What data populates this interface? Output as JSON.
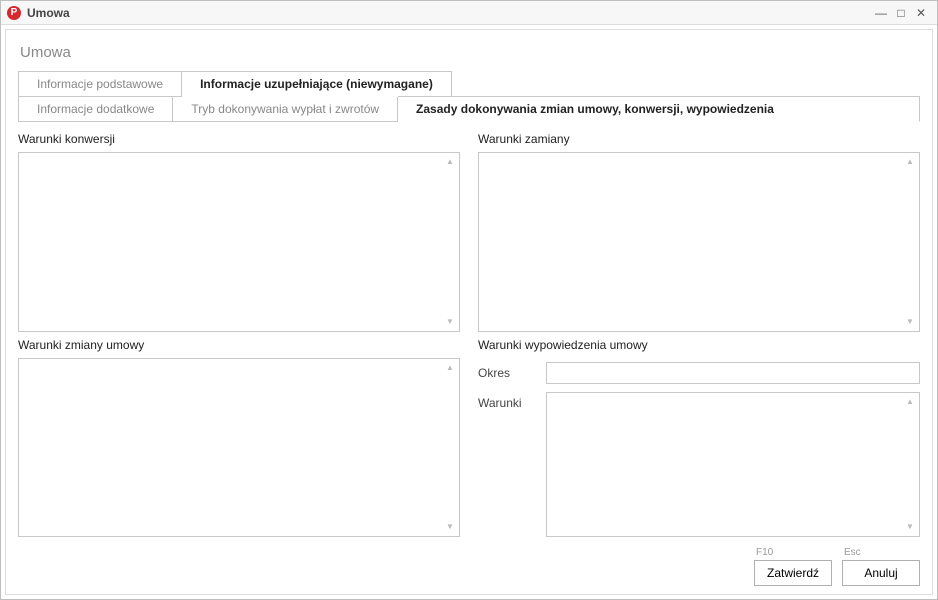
{
  "window": {
    "title": "Umowa",
    "icon_letter": "P"
  },
  "page": {
    "title": "Umowa"
  },
  "tabs_primary": [
    {
      "label": "Informacje podstawowe",
      "active": false
    },
    {
      "label": "Informacje uzupełniające (niewymagane)",
      "active": true
    }
  ],
  "tabs_secondary": [
    {
      "label": "Informacje dodatkowe",
      "active": false
    },
    {
      "label": "Tryb dokonywania wypłat i zwrotów",
      "active": false
    },
    {
      "label": "Zasady dokonywania zmian umowy, konwersji, wypowiedzenia",
      "active": true
    }
  ],
  "sections": {
    "warunki_konwersji": {
      "label": "Warunki konwersji",
      "value": ""
    },
    "warunki_zamiany": {
      "label": "Warunki zamiany",
      "value": ""
    },
    "warunki_zmiany_umowy": {
      "label": "Warunki zmiany umowy",
      "value": ""
    },
    "warunki_wypowiedzenia": {
      "label": "Warunki wypowiedzenia umowy",
      "okres_label": "Okres",
      "okres_value": "",
      "warunki_label": "Warunki",
      "warunki_value": ""
    }
  },
  "footer": {
    "confirm_label": "Zatwierdź",
    "confirm_shortcut": "F10",
    "cancel_label": "Anuluj",
    "cancel_shortcut": "Esc"
  }
}
